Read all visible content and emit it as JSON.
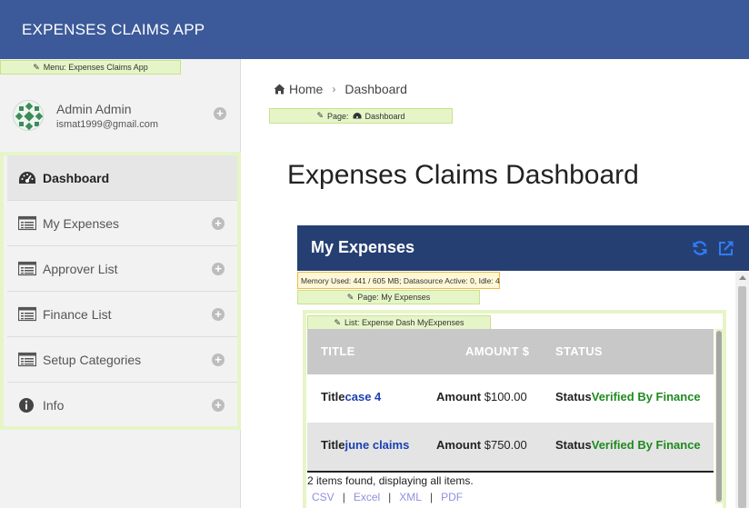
{
  "app": {
    "title": "EXPENSES CLAIMS APP"
  },
  "tags": {
    "menu": "Menu: Expenses Claims App",
    "page": "Page:",
    "page_target": "Dashboard",
    "mypage": "Page: My Expenses",
    "list": "List: Expense Dash MyExpenses",
    "memory": "Memory Used: 441 / 605 MB; Datasource Active: 0, Idle: 4"
  },
  "user": {
    "name": "Admin Admin",
    "email": "ismat1999@gmail.com"
  },
  "sidebar": {
    "items": [
      {
        "label": "Dashboard",
        "icon": "dashboard-icon",
        "active": true
      },
      {
        "label": "My Expenses",
        "icon": "list-icon"
      },
      {
        "label": "Approver List",
        "icon": "list-icon"
      },
      {
        "label": "Finance List",
        "icon": "list-icon"
      },
      {
        "label": "Setup Categories",
        "icon": "list-icon"
      },
      {
        "label": "Info",
        "icon": "info-icon"
      }
    ]
  },
  "breadcrumb": {
    "home": "Home",
    "current": "Dashboard"
  },
  "main": {
    "title": "Expenses Claims Dashboard"
  },
  "panel": {
    "title": "My Expenses",
    "columns": [
      "TITLE",
      "AMOUNT $",
      "STATUS"
    ],
    "rows": [
      {
        "title_label": "Title",
        "title": "case 4",
        "amount_label": "Amount",
        "amount": "$100.00",
        "status_label": "Status",
        "status": "Verified By Finance"
      },
      {
        "title_label": "Title",
        "title": "june claims",
        "amount_label": "Amount",
        "amount": "$750.00",
        "status_label": "Status",
        "status": "Verified By Finance"
      }
    ],
    "summary": "2 items found, displaying all items.",
    "exports": [
      "CSV",
      "Excel",
      "XML",
      "PDF"
    ]
  },
  "colors": {
    "header": "#3c5a99",
    "panel_header": "#263f73",
    "status_green": "#1f8a1f",
    "link_blue": "#1a3fb3",
    "edit_tag": "#e6f5c8"
  }
}
